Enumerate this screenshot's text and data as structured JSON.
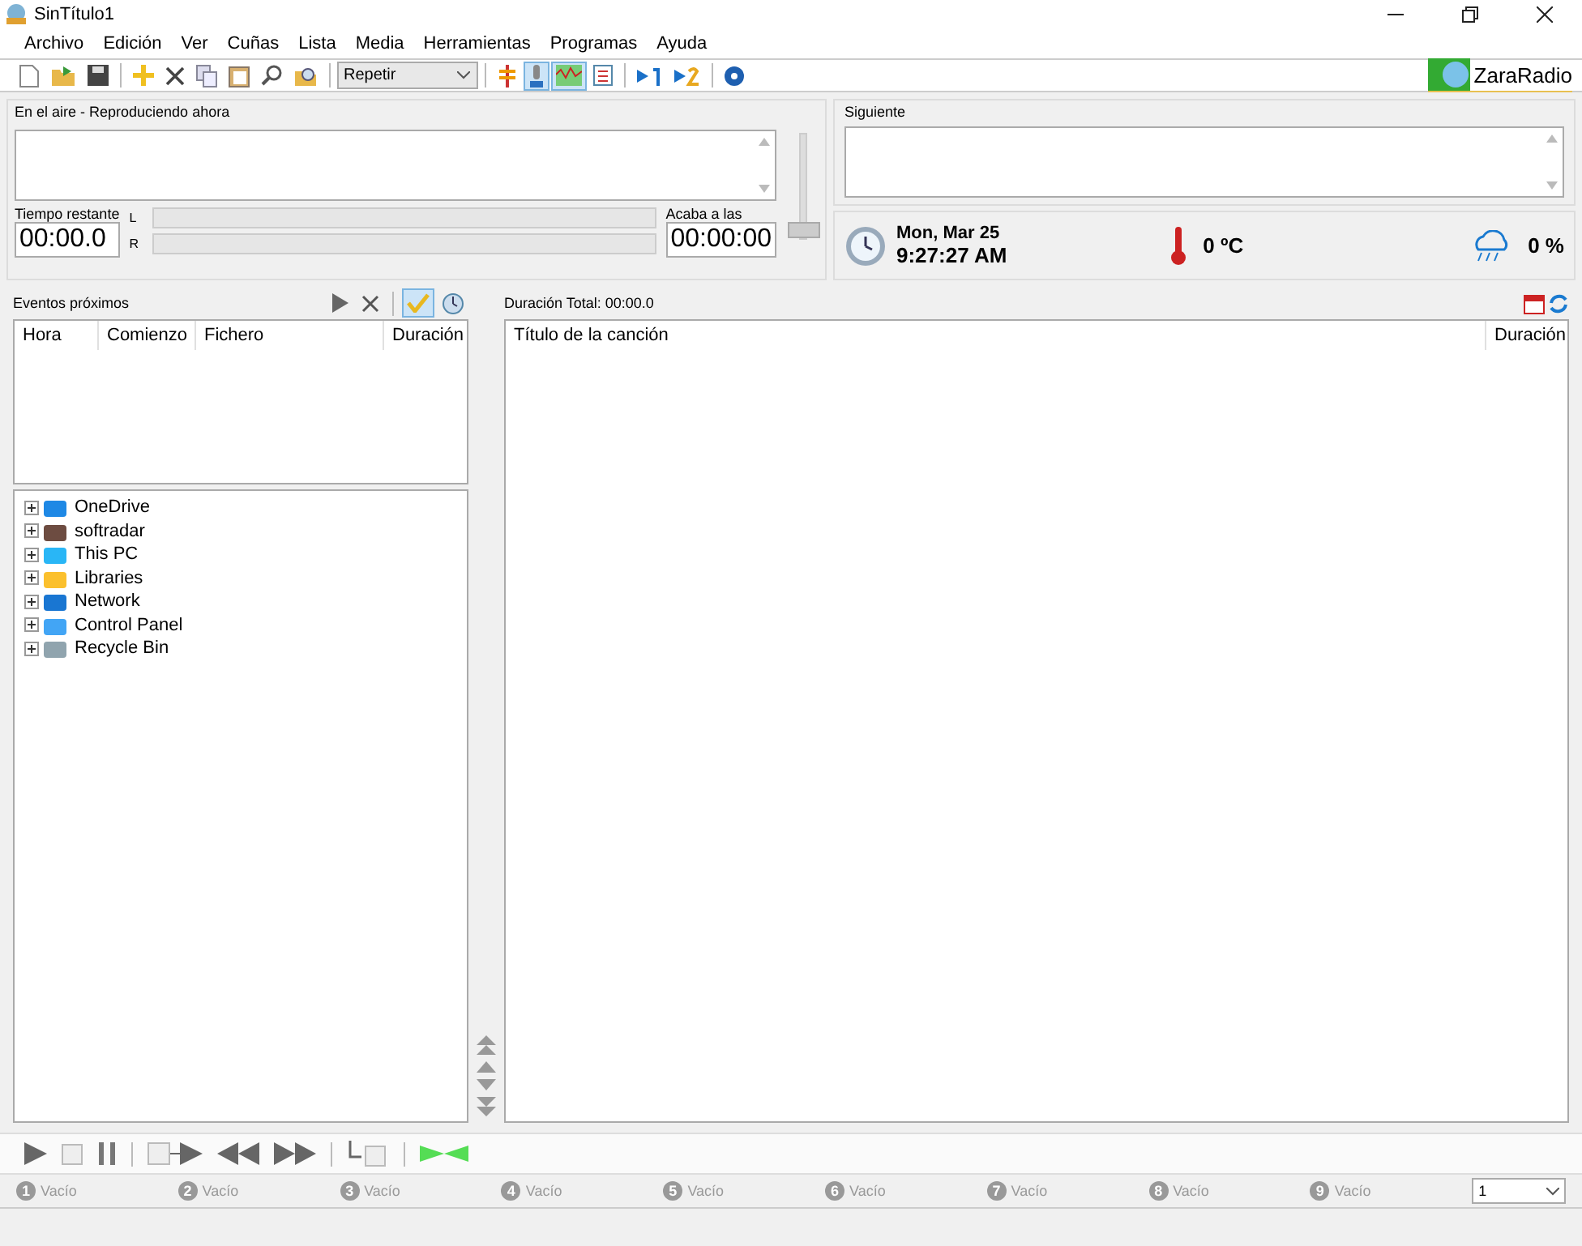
{
  "window": {
    "title": "SinTítulo1"
  },
  "menu": [
    "Archivo",
    "Edición",
    "Ver",
    "Cuñas",
    "Lista",
    "Media",
    "Herramientas",
    "Programas",
    "Ayuda"
  ],
  "toolbar": {
    "mode": "Repetir",
    "toggles": [
      {
        "pressed": false
      },
      {
        "pressed": true
      },
      {
        "pressed": true
      },
      {
        "pressed": false
      }
    ],
    "brand": "ZaraRadio"
  },
  "on_air": {
    "title": "En el aire - Reproduciendo ahora",
    "remaining_label": "Tiempo restante",
    "remaining": "00:00.0",
    "meters": [
      {
        "label": "L",
        "level": 0
      },
      {
        "label": "R",
        "level": 0
      }
    ],
    "ends_label": "Acaba a las",
    "ends": "00:00:00",
    "volume": {
      "level": 0.05
    }
  },
  "next": {
    "title": "Siguiente"
  },
  "info": {
    "date": "Mon, Mar 25",
    "time": "9:27:27 AM",
    "temperature": "0 ºC",
    "rain": "0 %"
  },
  "events": {
    "title": "Eventos próximos",
    "check_pressed": true,
    "columns": [
      "Hora",
      "Comienzo",
      "Fichero",
      "Duración"
    ]
  },
  "tree": [
    {
      "label": "OneDrive",
      "expanded": false
    },
    {
      "label": "softradar",
      "expanded": false
    },
    {
      "label": "This PC",
      "expanded": false
    },
    {
      "label": "Libraries",
      "expanded": false
    },
    {
      "label": "Network",
      "expanded": false
    },
    {
      "label": "Control Panel",
      "expanded": false
    },
    {
      "label": "Recycle Bin",
      "expanded": false
    }
  ],
  "playlist": {
    "total": "Duración Total: 00:00.0",
    "columns": [
      "Título de la canción",
      "Duración"
    ]
  },
  "slots": [
    {
      "number": "1",
      "label": "Vacío"
    },
    {
      "number": "2",
      "label": "Vacío"
    },
    {
      "number": "3",
      "label": "Vacío"
    },
    {
      "number": "4",
      "label": "Vacío"
    },
    {
      "number": "5",
      "label": "Vacío"
    },
    {
      "number": "6",
      "label": "Vacío"
    },
    {
      "number": "7",
      "label": "Vacío"
    },
    {
      "number": "8",
      "label": "Vacío"
    },
    {
      "number": "9",
      "label": "Vacío"
    }
  ],
  "slot_page": "1"
}
